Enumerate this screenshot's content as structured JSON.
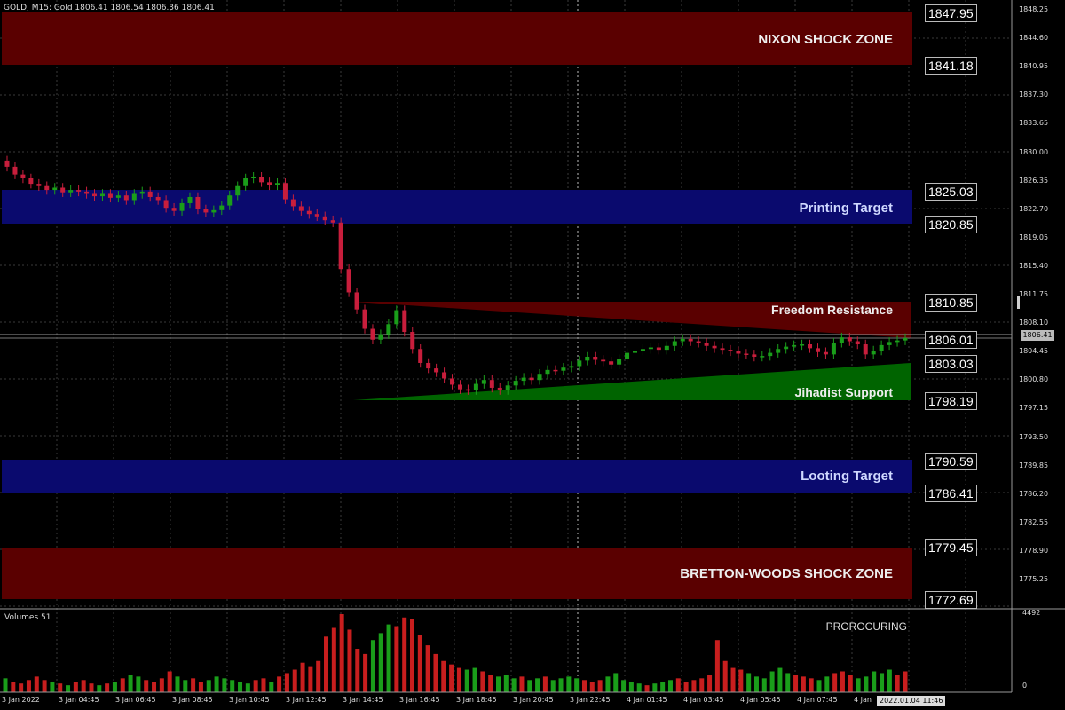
{
  "header": {
    "symbol_info": "GOLD, M15:  Gold  1806.41 1806.54 1806.36 1806.41"
  },
  "zones": [
    {
      "label": "NIXON SHOCK ZONE",
      "top_price": "1847.95",
      "bottom_price": "1841.18",
      "color": "#5a0000"
    },
    {
      "label": "Printing Target",
      "top_price": "1825.03",
      "bottom_price": "1820.85",
      "color": "#0a0a6e"
    },
    {
      "label": "Freedom Resistance",
      "top_price": "1810.85",
      "bottom_price": "",
      "color": "#5a0000"
    },
    {
      "label": "Jihadist Support",
      "top_price": "1803.03",
      "bottom_price": "1798.19",
      "color": "#006400"
    },
    {
      "label": "Looting Target",
      "top_price": "1790.59",
      "bottom_price": "1786.41",
      "color": "#0a0a6e"
    },
    {
      "label": "BRETTON-WOODS SHOCK ZONE",
      "top_price": "1779.45",
      "bottom_price": "1772.69",
      "color": "#5a0000"
    }
  ],
  "price_tags": [
    "1847.95",
    "1841.18",
    "1825.03",
    "1820.85",
    "1810.85",
    "1806.01",
    "1803.03",
    "1798.19",
    "1790.59",
    "1786.41",
    "1779.45",
    "1772.69"
  ],
  "y_axis_ticks": [
    "1848.25",
    "1844.60",
    "1840.95",
    "1837.30",
    "1833.65",
    "1830.00",
    "1826.35",
    "1822.70",
    "1819.05",
    "1815.40",
    "1811.75",
    "1808.10",
    "1804.45",
    "1800.80",
    "1797.15",
    "1793.50",
    "1789.85",
    "1786.20",
    "1782.55",
    "1778.90",
    "1775.25"
  ],
  "current_price": "1806.41",
  "volume": {
    "label": "Volumes 51",
    "max_label": "4492",
    "min_label": "0",
    "indicator_text": "PROROCURING"
  },
  "x_axis_ticks": [
    "3 Jan 2022",
    "3 Jan 04:45",
    "3 Jan 06:45",
    "3 Jan 08:45",
    "3 Jan 10:45",
    "3 Jan 12:45",
    "3 Jan 14:45",
    "3 Jan 16:45",
    "3 Jan 18:45",
    "3 Jan 20:45",
    "3 Jan 22:45",
    "4 Jan 01:45",
    "4 Jan 03:45",
    "4 Jan 05:45",
    "4 Jan 07:45",
    "4 Jan"
  ],
  "current_time": "2022.01.04 11:46",
  "colors": {
    "bull": "#1a9e1a",
    "bear": "#c81e3c",
    "grid": "#3a3a3a",
    "vol_up": "#1a9e1a",
    "vol_down": "#c81e1e"
  },
  "chart_data": {
    "type": "candlestick",
    "ylim": [
      1771.5,
      1850.0
    ],
    "series": [
      {
        "name": "GOLD M15",
        "close": [
          1828.5,
          1827.5,
          1827.0,
          1826.3,
          1826.0,
          1825.5,
          1825.8,
          1825.2,
          1825.5,
          1825.3,
          1825.0,
          1824.7,
          1825.0,
          1824.5,
          1824.8,
          1824.2,
          1825.0,
          1825.3,
          1824.6,
          1824.2,
          1823.2,
          1822.8,
          1823.8,
          1824.6,
          1823.0,
          1822.6,
          1822.9,
          1823.5,
          1824.8,
          1826.0,
          1827.0,
          1827.2,
          1826.5,
          1826.1,
          1826.4,
          1824.3,
          1823.4,
          1822.8,
          1822.4,
          1822.1,
          1821.6,
          1821.3,
          1815.3,
          1812.3,
          1810.1,
          1807.6,
          1806.2,
          1806.9,
          1808.2,
          1810.0,
          1807.2,
          1805.0,
          1803.2,
          1802.5,
          1802.0,
          1801.2,
          1800.4,
          1799.8,
          1799.7,
          1800.5,
          1801.0,
          1800.0,
          1799.7,
          1800.3,
          1800.9,
          1801.3,
          1801.0,
          1801.8,
          1802.3,
          1802.2,
          1802.6,
          1802.8,
          1803.5,
          1804.0,
          1803.6,
          1803.4,
          1803.0,
          1803.7,
          1804.5,
          1804.8,
          1805.0,
          1805.2,
          1804.9,
          1805.4,
          1806.0,
          1806.3,
          1806.0,
          1805.8,
          1805.4,
          1805.1,
          1804.9,
          1804.7,
          1804.4,
          1804.3,
          1804.0,
          1804.1,
          1804.5,
          1805.0,
          1805.3,
          1805.5,
          1805.6,
          1805.1,
          1804.6,
          1804.3,
          1805.8,
          1806.5,
          1806.0,
          1805.6,
          1804.3,
          1804.8,
          1805.5,
          1805.9,
          1806.1,
          1806.4
        ]
      }
    ],
    "volume": [
      800,
      600,
      500,
      700,
      900,
      700,
      600,
      500,
      400,
      600,
      700,
      500,
      400,
      500,
      600,
      800,
      1000,
      900,
      700,
      600,
      800,
      1200,
      900,
      700,
      800,
      600,
      700,
      900,
      800,
      700,
      600,
      500,
      700,
      800,
      600,
      900,
      1100,
      1300,
      1700,
      1500,
      1800,
      3200,
      3700,
      4492,
      3600,
      2500,
      2200,
      3000,
      3400,
      3900,
      3800,
      4300,
      4200,
      3300,
      2700,
      2200,
      1800,
      1600,
      1400,
      1300,
      1400,
      1200,
      1000,
      900,
      1000,
      800,
      900,
      700,
      800,
      900,
      700,
      800,
      900,
      800,
      700,
      600,
      700,
      900,
      1100,
      700,
      600,
      500,
      400,
      500,
      600,
      700,
      800,
      600,
      700,
      800,
      1000,
      3000,
      1800,
      1400,
      1300,
      1100,
      900,
      800,
      1200,
      1400,
      1100,
      1000,
      900,
      800,
      700,
      900,
      1100,
      1200,
      1000,
      800,
      900,
      1200,
      1100,
      1300,
      1000,
      1200
    ]
  }
}
